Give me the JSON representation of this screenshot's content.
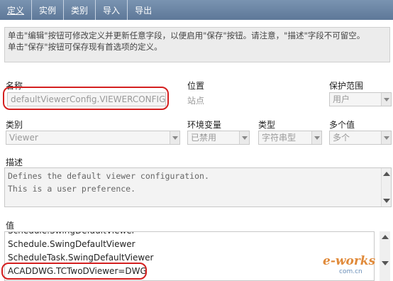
{
  "tabs": [
    "定义",
    "实例",
    "类别",
    "导入",
    "导出"
  ],
  "info": {
    "line1": "单击\"编辑\"按钮可修改定义并更新任意字段，以便启用\"保存\"按钮。请注意，\"描述\"字段不可留空。",
    "line2": "单击\"保存\"按钮可保存现有首选项的定义。"
  },
  "name": {
    "label": "名称",
    "value": "defaultViewerConfig.VIEWERCONFIG"
  },
  "location": {
    "label": "位置",
    "value": "站点"
  },
  "scope": {
    "label": "保护范围",
    "value": "用户"
  },
  "category": {
    "label": "类别",
    "value": "Viewer"
  },
  "env": {
    "label": "环境变量",
    "value": "已禁用"
  },
  "type": {
    "label": "类型",
    "value": "字符串型"
  },
  "multi": {
    "label": "多个值",
    "value": "多个"
  },
  "description": {
    "label": "描述",
    "line1": "Defines the default viewer configuration.",
    "line2": "This is a user preference."
  },
  "values": {
    "label": "值",
    "items": [
      "Schedule.SwingDefaultViewer",
      "Schedule.SwingDefaultViewer",
      "ScheduleTask.SwingDefaultViewer",
      "ACADDWG.TCTwoDViewer=DWG"
    ]
  },
  "watermark": {
    "main": "e-works",
    "sub": "com.cn"
  },
  "colors": {
    "tabbar": "#6a86a6",
    "highlight": "#d42020"
  }
}
